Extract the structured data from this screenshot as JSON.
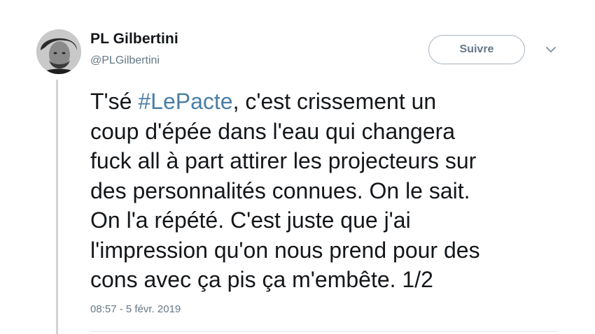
{
  "author": {
    "display_name": "PL Gilbertini",
    "handle": "@PLGilbertini"
  },
  "actions": {
    "follow_label": "Suivre",
    "menu_icon": "chevron-down-icon"
  },
  "tweet": {
    "line1_pre": "T'sé ",
    "hashtag": "#LePacte",
    "line1_post": ", c'est crissement un",
    "line2": "coup d'épée dans l'eau qui changera",
    "line3": "fuck all à part attirer les projecteurs sur",
    "line4": "des personnalités connues. On le sait.",
    "line5": "On l'a répété. C'est juste que j'ai",
    "line6": "l'impression qu'on nous prend pour des",
    "line7": "cons avec ça pis ça m'embête. 1/2",
    "timestamp": "08:57 - 5 févr. 2019"
  },
  "colors": {
    "text": "#14171a",
    "secondary": "#657786",
    "hashtag": "#4a7fa6",
    "thread_line": "#d0d4d8"
  }
}
